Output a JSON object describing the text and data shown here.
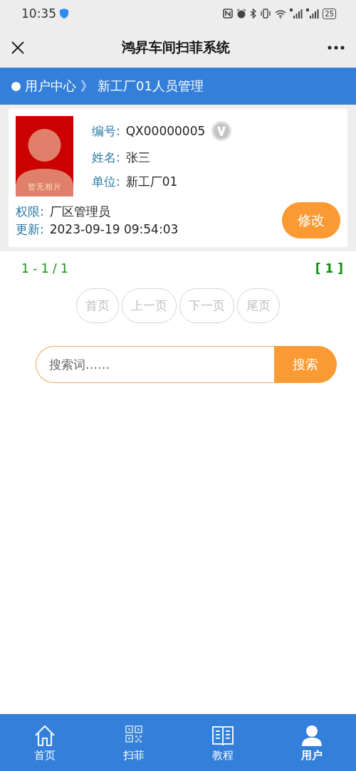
{
  "status_bar": {
    "time": "10:35",
    "battery": "25"
  },
  "title_bar": {
    "title": "鸿昇车间扫菲系统"
  },
  "breadcrumb": {
    "section": "用户中心",
    "separator": "》",
    "page": "新工厂01人员管理"
  },
  "user_card": {
    "photo_caption": "暂无相片",
    "verified": true,
    "fields": [
      {
        "label": "编号:",
        "value": "QX00000005"
      },
      {
        "label": "姓名:",
        "value": "张三"
      },
      {
        "label": "单位:",
        "value": "新工厂01"
      }
    ],
    "footer_fields": [
      {
        "label": "权限:",
        "value": "厂区管理员"
      },
      {
        "label": "更新:",
        "value": "2023-09-19 09:54:03"
      }
    ],
    "edit_button": "修改"
  },
  "pagination": {
    "range": "1 - 1 / 1",
    "current_page": "[ 1 ]",
    "buttons": [
      {
        "label": "首页",
        "disabled": true
      },
      {
        "label": "上一页",
        "disabled": true
      },
      {
        "label": "下一页",
        "disabled": true
      },
      {
        "label": "尾页",
        "disabled": true
      }
    ]
  },
  "search": {
    "placeholder": "搜索词……",
    "button": "搜索"
  },
  "bottom_nav": [
    {
      "kind": "home",
      "label": "首页",
      "selected": false
    },
    {
      "kind": "qr",
      "label": "扫菲",
      "selected": false
    },
    {
      "kind": "book",
      "label": "教程",
      "selected": false
    },
    {
      "kind": "user",
      "label": "用户",
      "selected": true
    }
  ]
}
